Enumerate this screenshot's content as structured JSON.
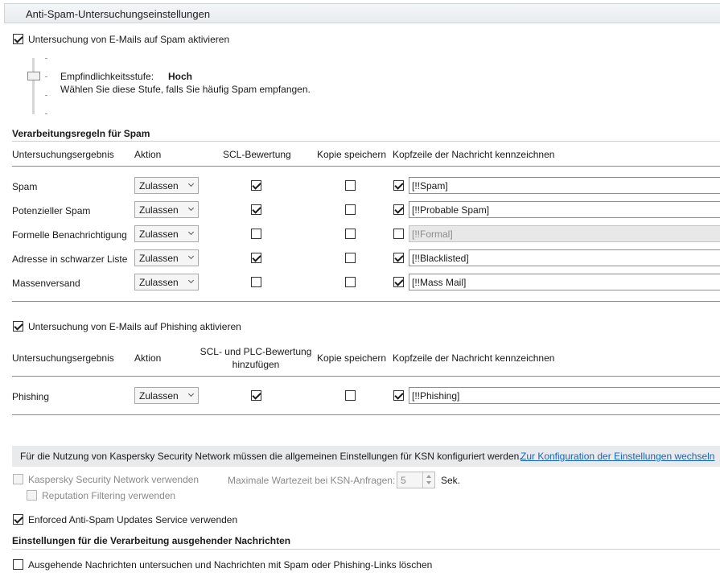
{
  "header": {
    "title": "Anti-Spam-Untersuchungseinstellungen"
  },
  "spam_scan": {
    "enable_label": "Untersuchung von E-Mails auf Spam aktivieren",
    "enabled": true,
    "sensitivity_label": "Empfindlichkeitsstufe:",
    "sensitivity_value": "Hoch",
    "sensitivity_hint": "Wählen Sie diese Stufe, falls Sie häufig Spam empfangen.",
    "slider_levels": 4,
    "slider_selected_index": 1
  },
  "spam_rules": {
    "section_title": "Verarbeitungsregeln für Spam",
    "columns": {
      "result": "Untersuchungsergebnis",
      "action": "Aktion",
      "scl": "SCL-Bewertung",
      "copy": "Kopie speichern",
      "header": "Kopfzeile der Nachricht kennzeichnen"
    },
    "rows": [
      {
        "result": "Spam",
        "action": "Zulassen",
        "scl": true,
        "copy": false,
        "mark": true,
        "tag": "[!!Spam]",
        "tag_disabled": false
      },
      {
        "result": "Potenzieller Spam",
        "action": "Zulassen",
        "scl": true,
        "copy": false,
        "mark": true,
        "tag": "[!!Probable Spam]",
        "tag_disabled": false
      },
      {
        "result": "Formelle Benachrichtigung",
        "action": "Zulassen",
        "scl": false,
        "copy": false,
        "mark": false,
        "tag": "[!!Formal]",
        "tag_disabled": true
      },
      {
        "result": "Adresse in schwarzer Liste",
        "action": "Zulassen",
        "scl": true,
        "copy": false,
        "mark": true,
        "tag": "[!!Blacklisted]",
        "tag_disabled": false
      },
      {
        "result": "Massenversand",
        "action": "Zulassen",
        "scl": false,
        "copy": false,
        "mark": true,
        "tag": "[!!Mass Mail]",
        "tag_disabled": false
      }
    ]
  },
  "phishing": {
    "enable_label": "Untersuchung von E-Mails auf Phishing aktivieren",
    "enabled": true,
    "columns": {
      "result": "Untersuchungsergebnis",
      "action": "Aktion",
      "scl_line1": "SCL- und PLC-Bewertung",
      "scl_line2": "hinzufügen",
      "copy": "Kopie speichern",
      "header": "Kopfzeile der Nachricht kennzeichnen"
    },
    "rows": [
      {
        "result": "Phishing",
        "action": "Zulassen",
        "scl": true,
        "copy": false,
        "mark": true,
        "tag": "[!!Phishing]",
        "tag_disabled": false
      }
    ]
  },
  "ksn": {
    "notice": "Für die Nutzung von Kaspersky Security Network müssen die allgemeinen Einstellungen für KSN konfiguriert werden.",
    "link": "Zur Konfiguration der Einstellungen wechseln",
    "use_ksn_label": "Kaspersky Security Network verwenden",
    "use_ksn": false,
    "reputation_label": "Reputation Filtering verwenden",
    "reputation": false,
    "wait_label": "Maximale Wartezeit bei KSN-Anfragen:",
    "wait_value": "5",
    "wait_unit": "Sek."
  },
  "enforced": {
    "label": "Enforced Anti-Spam Updates Service verwenden",
    "enabled": true
  },
  "outgoing": {
    "section_title": "Einstellungen für die Verarbeitung ausgehender Nachrichten",
    "label": "Ausgehende Nachrichten untersuchen und Nachrichten mit Spam oder Phishing-Links löschen",
    "enabled": false
  }
}
